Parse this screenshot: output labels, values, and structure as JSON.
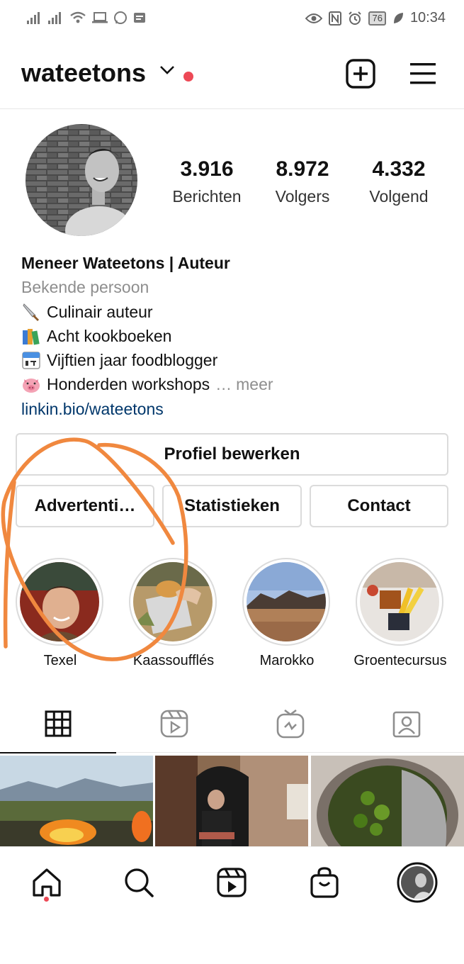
{
  "status_bar": {
    "battery": "76",
    "time": "10:34"
  },
  "header": {
    "username": "wateetons"
  },
  "profile": {
    "stats": [
      {
        "value": "3.916",
        "label": "Berichten"
      },
      {
        "value": "8.972",
        "label": "Volgers"
      },
      {
        "value": "4.332",
        "label": "Volgend"
      }
    ]
  },
  "bio": {
    "name": "Meneer Wateetons | Auteur",
    "category": "Bekende persoon",
    "lines": [
      {
        "emoji": "knife",
        "text": "Culinair auteur"
      },
      {
        "emoji": "books",
        "text": "Acht kookboeken"
      },
      {
        "emoji": "calendar",
        "text": "Vijftien jaar foodblogger"
      },
      {
        "emoji": "pig",
        "text": "Honderden workshops"
      }
    ],
    "more_ellipsis": "…",
    "more_label": "meer",
    "link": "linkin.bio/wateetons"
  },
  "buttons": {
    "edit_profile": "Profiel bewerken",
    "ads": "Advertenti…",
    "insights": "Statistieken",
    "contact": "Contact"
  },
  "highlights": [
    {
      "label": "Texel"
    },
    {
      "label": "Kaassoufflés"
    },
    {
      "label": "Marokko"
    },
    {
      "label": "Groentecursus"
    }
  ],
  "tabs": {
    "active": "grid",
    "items": [
      "grid-icon",
      "reels-icon",
      "igtv-icon",
      "tagged-icon"
    ]
  },
  "colors": {
    "accent_red": "#ed4956",
    "link": "#00376b",
    "muted": "#8e8e8e",
    "annotation": "#f0883f"
  },
  "bottom_nav": {
    "items": [
      "home-icon",
      "search-icon",
      "reels-icon",
      "shop-icon",
      "profile-avatar"
    ]
  }
}
